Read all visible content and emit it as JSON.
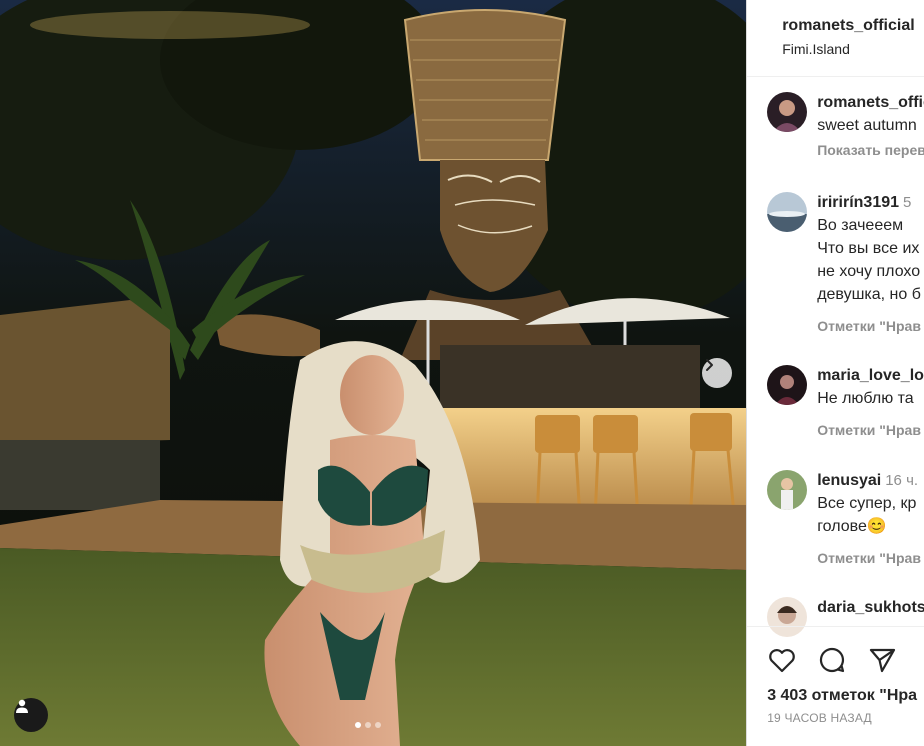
{
  "post": {
    "username": "romanets_official",
    "location": "Fimi.Island",
    "carousel": {
      "count": 3,
      "active": 1
    }
  },
  "comments": [
    {
      "username": "romanets_offic",
      "time": "",
      "lines": [
        "sweet autumn"
      ],
      "meta": "Показать перев",
      "avatar_color": "#5a3a4a"
    },
    {
      "username": "iririrín3191",
      "time": "5",
      "lines": [
        "Во зачееем",
        "Что вы все их",
        "не хочу плохо",
        "девушка, но б"
      ],
      "meta": "Отметки \"Нрав",
      "avatar_color": "#8fa6b8"
    },
    {
      "username": "maria_love_lo",
      "time": "",
      "lines": [
        "Не люблю та"
      ],
      "meta": "Отметки \"Нрав",
      "avatar_color": "#3a2430"
    },
    {
      "username": "lenusyai",
      "time": "16 ч.",
      "lines": [
        "Все супер, кр",
        "голове😊"
      ],
      "meta": "Отметки \"Нрав",
      "avatar_color": "#6b8a5a"
    },
    {
      "username": "daria_sukhots",
      "time": "",
      "lines": [],
      "meta": "",
      "avatar_color": "#d8c8bc"
    }
  ],
  "actions": {
    "icons": [
      "heart-icon",
      "comment-icon",
      "share-icon"
    ],
    "likes_text": "3 403 отметок \"Нра",
    "posted_text": "19 ЧАСОВ НАЗАД"
  },
  "colors": {
    "meta_gray": "#8e8e8e",
    "text": "#262626",
    "divider": "#dbdbdb"
  }
}
